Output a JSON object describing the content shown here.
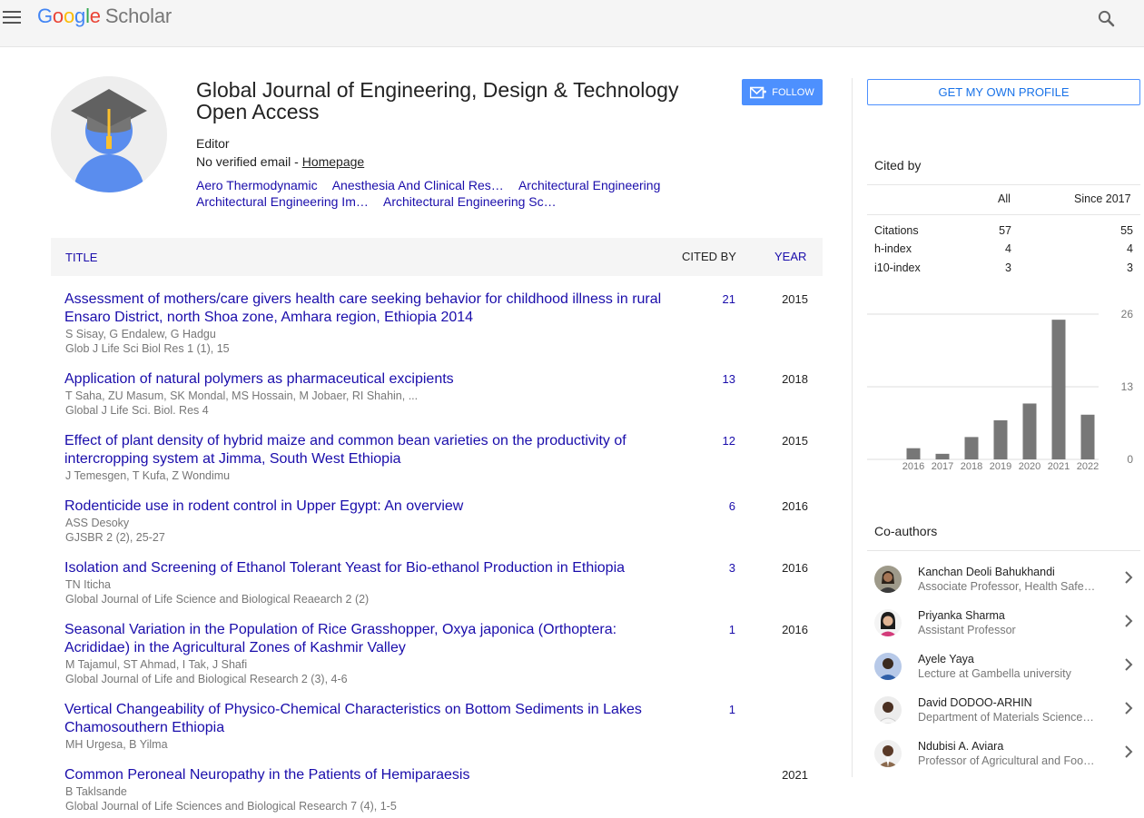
{
  "header": {
    "logo_google": [
      "G",
      "o",
      "o",
      "g",
      "l",
      "e"
    ],
    "logo_scholar": "Scholar",
    "menu_icon": "hamburger-menu-icon",
    "search_icon": "search-icon"
  },
  "profile": {
    "title": "Global Journal of Engineering, Design & Technology Open Access",
    "role": "Editor",
    "email_text": "No verified email - ",
    "homepage_label": "Homepage",
    "follow_label": "FOLLOW",
    "interests": [
      "Aero Thermodynamic",
      "Anesthesia And Clinical Res…",
      "Architectural Engineering",
      "Architectural Engineering Im…",
      "Architectural Engineering Sc…"
    ]
  },
  "table": {
    "col_title": "TITLE",
    "col_cited": "CITED BY",
    "col_year": "YEAR",
    "articles": [
      {
        "title": "Assessment of mothers/care givers health care seeking behavior for childhood illness in rural Ensaro District, north Shoa zone, Amhara region, Ethiopia 2014",
        "authors": "S Sisay, G Endalew, G Hadgu",
        "venue": "Glob J Life Sci Biol Res 1 (1), 15",
        "cited": "21",
        "year": "2015"
      },
      {
        "title": "Application of natural polymers as pharmaceutical excipients",
        "authors": "T Saha, ZU Masum, SK Mondal, MS Hossain, M Jobaer, RI Shahin, ...",
        "venue": "Global J Life Sci. Biol. Res 4",
        "cited": "13",
        "year": "2018"
      },
      {
        "title": "Effect of plant density of hybrid maize and common bean varieties on the productivity of intercropping system at Jimma, South West Ethiopia",
        "authors": "J Temesgen, T Kufa, Z Wondimu",
        "venue": "",
        "cited": "12",
        "year": "2015"
      },
      {
        "title": "Rodenticide use in rodent control in Upper Egypt: An overview",
        "authors": "ASS Desoky",
        "venue": "GJSBR 2 (2), 25-27",
        "cited": "6",
        "year": "2016"
      },
      {
        "title": "Isolation and Screening of Ethanol Tolerant Yeast for Bio-ethanol Production in Ethiopia",
        "authors": "TN Iticha",
        "venue": "Global Journal of Life Science and Biological Reaearch 2 (2)",
        "cited": "3",
        "year": "2016"
      },
      {
        "title": "Seasonal Variation in the Population of Rice Grasshopper, Oxya japonica (Orthoptera: Acrididae) in the Agricultural Zones of Kashmir Valley",
        "authors": "M Tajamul, ST Ahmad, I Tak, J Shafi",
        "venue": "Global Journal of Life and Biological Research 2 (3), 4-6",
        "cited": "1",
        "year": "2016"
      },
      {
        "title": "Vertical Changeability of Physico-Chemical Characteristics on Bottom Sediments in Lakes Chamosouthern Ethiopia",
        "authors": "MH Urgesa, B Yilma",
        "venue": "",
        "cited": "1",
        "year": ""
      },
      {
        "title": "Common Peroneal Neuropathy in the Patients of Hemiparaesis",
        "authors": "B Taklsande",
        "venue": "Global Journal of Life Sciences and Biological Research 7 (4), 1-5",
        "cited": "",
        "year": "2021"
      }
    ]
  },
  "sidebar": {
    "own_profile_label": "GET MY OWN PROFILE",
    "cited_by_title": "Cited by",
    "col_all": "All",
    "col_since": "Since 2017",
    "stats": [
      {
        "label": "Citations",
        "all": "57",
        "since": "55"
      },
      {
        "label": "h-index",
        "all": "4",
        "since": "4"
      },
      {
        "label": "i10-index",
        "all": "3",
        "since": "3"
      }
    ],
    "coauthors_title": "Co-authors",
    "coauthors": [
      {
        "name": "Kanchan Deoli Bahukhandi",
        "affiliation": "Associate Professor, Health Safe…"
      },
      {
        "name": "Priyanka Sharma",
        "affiliation": "Assistant Professor"
      },
      {
        "name": "Ayele Yaya",
        "affiliation": "Lecture at Gambella university"
      },
      {
        "name": "David DODOO-ARHIN",
        "affiliation": "Department of Materials Science…"
      },
      {
        "name": "Ndubisi A. Aviara",
        "affiliation": "Professor of Agricultural and Foo…"
      }
    ]
  },
  "chart_data": {
    "type": "bar",
    "categories": [
      "2016",
      "2017",
      "2018",
      "2019",
      "2020",
      "2021",
      "2022"
    ],
    "values": [
      2,
      1,
      4,
      7,
      10,
      25,
      8
    ],
    "yticks": [
      "0",
      "13",
      "26"
    ],
    "ylim": [
      0,
      26
    ],
    "bar_color": "#777777",
    "grid": true
  }
}
